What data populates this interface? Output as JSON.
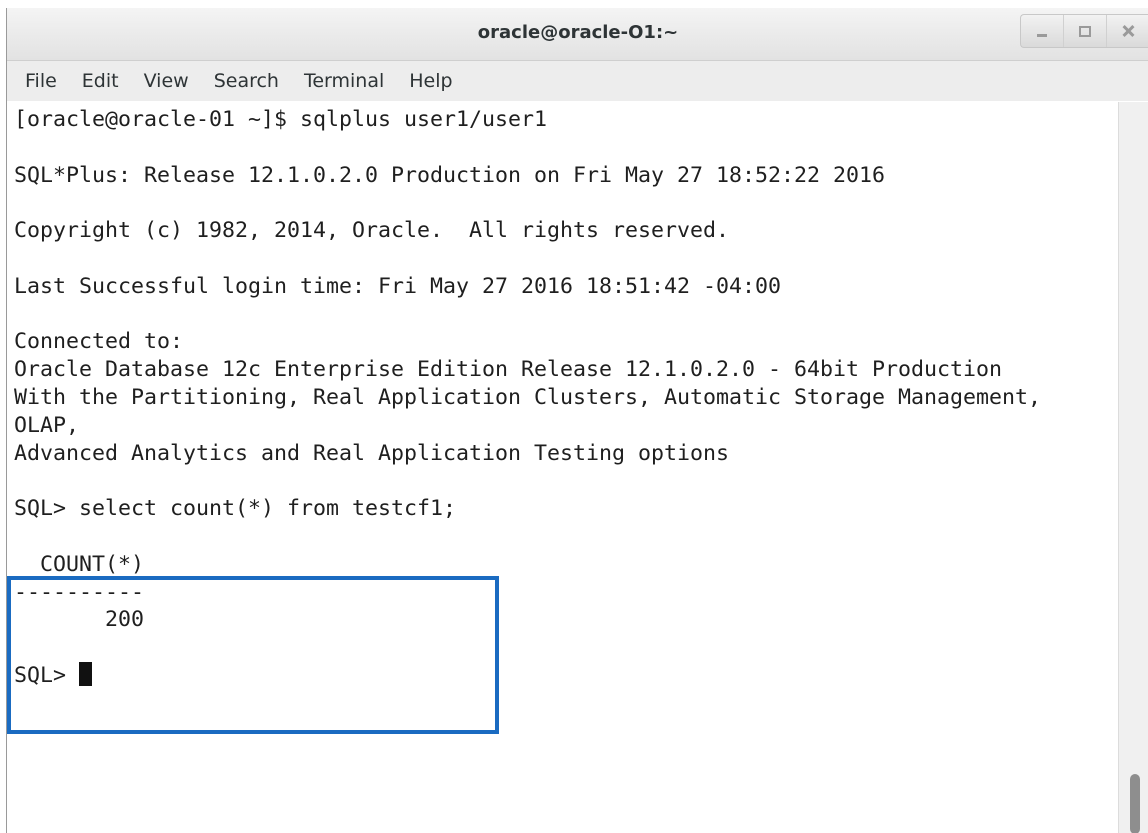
{
  "window": {
    "title": "oracle@oracle-O1:~"
  },
  "menu": {
    "items": [
      "File",
      "Edit",
      "View",
      "Search",
      "Terminal",
      "Help"
    ]
  },
  "terminal": {
    "lines": [
      "[oracle@oracle-01 ~]$ sqlplus user1/user1",
      "",
      "SQL*Plus: Release 12.1.0.2.0 Production on Fri May 27 18:52:22 2016",
      "",
      "Copyright (c) 1982, 2014, Oracle.  All rights reserved.",
      "",
      "Last Successful login time: Fri May 27 2016 18:51:42 -04:00",
      "",
      "Connected to:",
      "Oracle Database 12c Enterprise Edition Release 12.1.0.2.0 - 64bit Production",
      "With the Partitioning, Real Application Clusters, Automatic Storage Management,",
      "OLAP,",
      "Advanced Analytics and Real Application Testing options",
      "",
      "SQL> select count(*) from testcf1;",
      "",
      "  COUNT(*)",
      "----------",
      "       200",
      ""
    ],
    "prompt": "SQL> "
  },
  "colors": {
    "highlight_border": "#1a6bc1",
    "text": "#1f1f1f",
    "background": "#ffffff"
  },
  "icons": {
    "minimize": "minimize-icon",
    "maximize": "maximize-icon",
    "close": "close-icon",
    "cursor": "block-cursor"
  }
}
